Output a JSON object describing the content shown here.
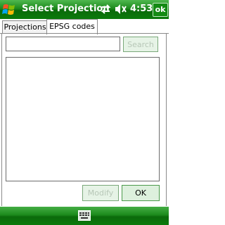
{
  "title_bar": {
    "title": "Select Projection",
    "time": "4:53",
    "ok_label": "ok",
    "icons": [
      "windows-start-icon",
      "connectivity-icon",
      "volume-icon"
    ]
  },
  "tabs": [
    {
      "label": "Projections",
      "selected": false
    },
    {
      "label": "EPSG codes",
      "selected": true
    }
  ],
  "search": {
    "input_value": "",
    "button_label": "Search",
    "button_enabled": false
  },
  "result_list": [],
  "buttons": {
    "modify_label": "Modify",
    "modify_enabled": false,
    "ok_label": "OK"
  },
  "bottom_bar": {
    "icon": "keyboard-icon"
  },
  "colors": {
    "title_bar_green": "#1d8a1d",
    "disabled_text": "#b7c7b7"
  }
}
